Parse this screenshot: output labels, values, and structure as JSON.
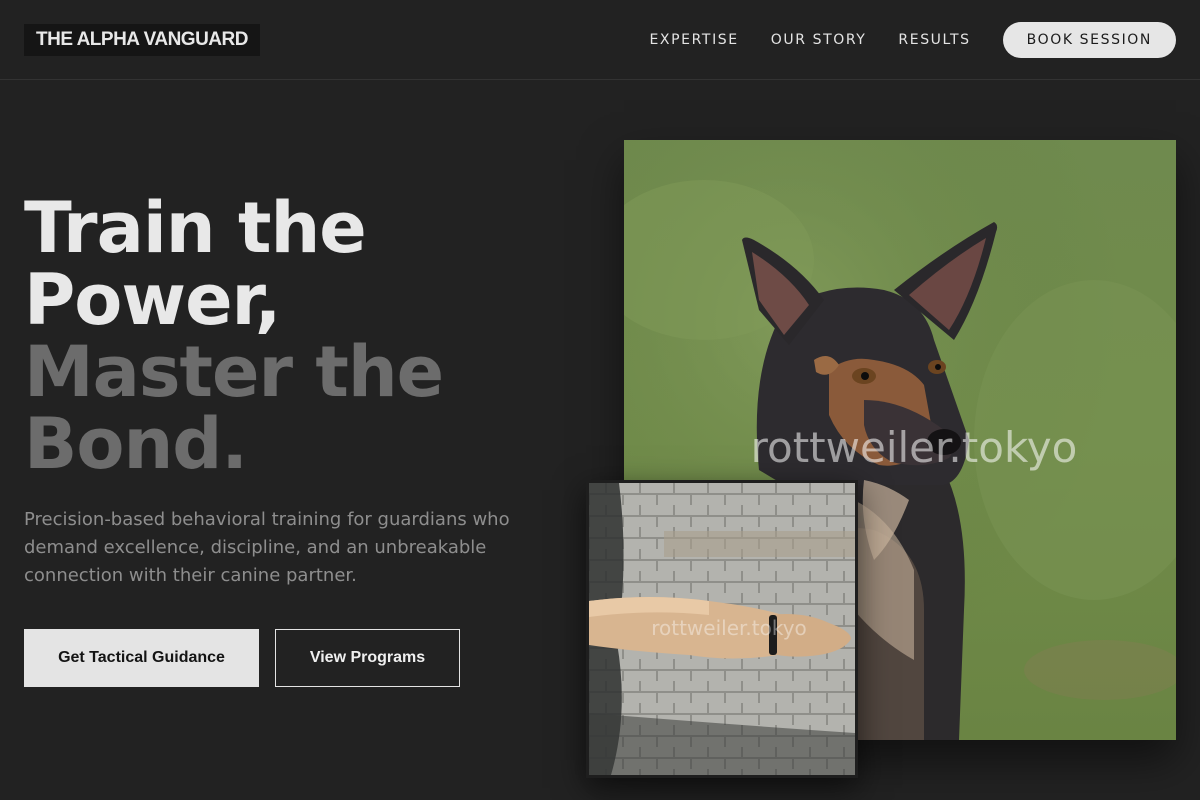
{
  "brand": {
    "logo_text": "THE ALPHA VANGUARD"
  },
  "nav": {
    "links": [
      "EXPERTISE",
      "OUR STORY",
      "RESULTS"
    ],
    "cta_label": "BOOK SESSION"
  },
  "hero": {
    "title_line1": "Train the",
    "title_line2": "Power,",
    "title_line3": "Master the",
    "title_line4": "Bond.",
    "subtitle": "Precision-based behavioral training for guardians who demand excellence, discipline, and an unbreakable connection with their canine partner.",
    "primary_button": "Get Tactical Guidance",
    "secondary_button": "View Programs"
  },
  "images": {
    "main_watermark": "rottweiler.tokyo",
    "small_watermark": "rottweiler.tokyo"
  },
  "colors": {
    "background": "#222222",
    "text_primary": "#e8e8e8",
    "text_muted": "#6c6c6c",
    "button_light": "#e4e4e4"
  }
}
